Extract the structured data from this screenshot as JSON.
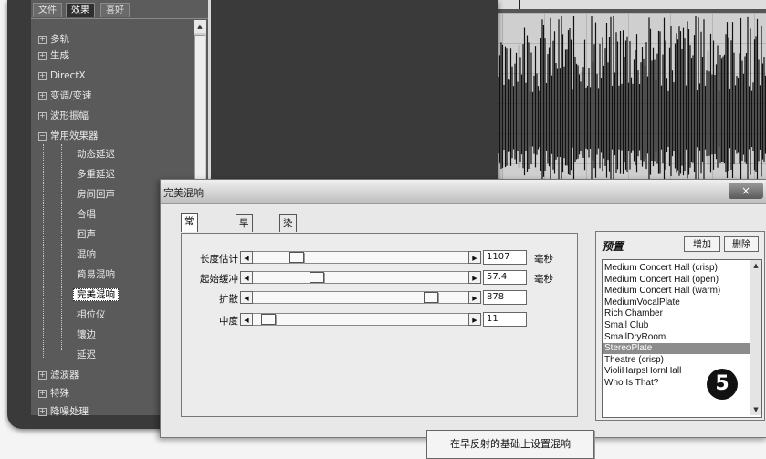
{
  "top_tabs": [
    "文件",
    "效果",
    "喜好"
  ],
  "tree": {
    "categories": [
      "多轨",
      "生成",
      "DirectX",
      "变调/变速",
      "波形振幅",
      "常用效果器"
    ],
    "effects": [
      "动态延迟",
      "多重延迟",
      "房间回声",
      "合唱",
      "回声",
      "混响",
      "简易混响",
      "完美混响",
      "相位仪",
      "镶边",
      "延迟"
    ],
    "selected_effect": "完美混响",
    "bottom_categories": [
      "滤波器",
      "特殊",
      "降噪处理"
    ]
  },
  "dialog": {
    "title": "完美混响",
    "close": "×",
    "tabs": [
      "常规混响",
      "早反射",
      "染色"
    ],
    "params": [
      {
        "label": "长度估计",
        "value": "1107",
        "unit": "毫秒",
        "position": 0.18
      },
      {
        "label": "起始缓冲",
        "value": "57.4",
        "unit": "毫秒",
        "position": 0.28
      },
      {
        "label": "扩散",
        "value": "878",
        "unit": "",
        "position": 0.85
      },
      {
        "label": "中度",
        "value": "11",
        "unit": "",
        "position": 0.04
      }
    ],
    "apply_button": "在早反射的基础上设置混响"
  },
  "presets": {
    "title": "预置",
    "add": "增加",
    "delete": "删除",
    "items": [
      "Medium Concert Hall (crisp)",
      "Medium Concert Hall (open)",
      "Medium Concert Hall (warm)",
      "MediumVocalPlate",
      "Rich Chamber",
      "Small Club",
      "SmallDryRoom",
      "StereoPlate",
      "Theatre (crisp)",
      "VioliHarpsHornHall",
      "Who Is That?"
    ],
    "selected": "StereoPlate"
  },
  "step_badge": "5",
  "colors": {
    "wave": "#111111",
    "grid": "#b5b5b5",
    "selected": "#8c8c8c"
  }
}
